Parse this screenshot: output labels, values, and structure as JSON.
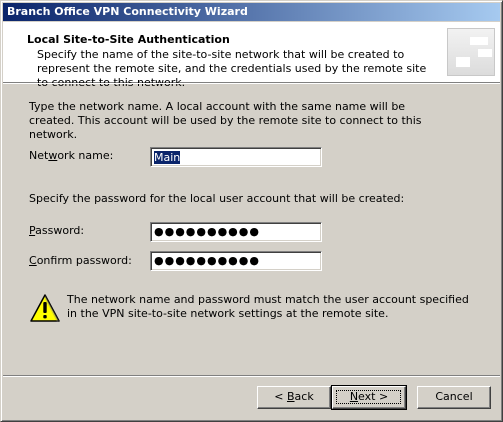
{
  "window": {
    "title": "Branch Office VPN Connectivity Wizard"
  },
  "header": {
    "title": "Local Site-to-Site Authentication",
    "description": "Specify the name of the site-to-site network that will be created to represent the remote site, and the credentials used by the remote site to connect to this network."
  },
  "content": {
    "intro": "Type the network name.  A local account with the same name will be created. This account will be used by the remote site to connect to this network.",
    "network_name": {
      "label_pre": "Net",
      "label_accel": "w",
      "label_post": "ork name:",
      "value": "Main"
    },
    "password_prompt": "Specify the password for the local user account that will be created:",
    "password": {
      "label_accel": "P",
      "label_post": "assword:",
      "masked_value": "●●●●●●●●●●"
    },
    "confirm_password": {
      "label_accel": "C",
      "label_post": "onfirm password:",
      "masked_value": "●●●●●●●●●●"
    },
    "warning": "The network name and password must match the user account specified in the VPN site-to-site network settings at the remote site."
  },
  "buttons": {
    "back_prefix": "< ",
    "back_accel": "B",
    "back_suffix": "ack",
    "next_accel": "N",
    "next_suffix": "ext >",
    "cancel": "Cancel"
  },
  "icons": {
    "header": "wizard-banner-icon",
    "warning": "warning-triangle-icon"
  }
}
